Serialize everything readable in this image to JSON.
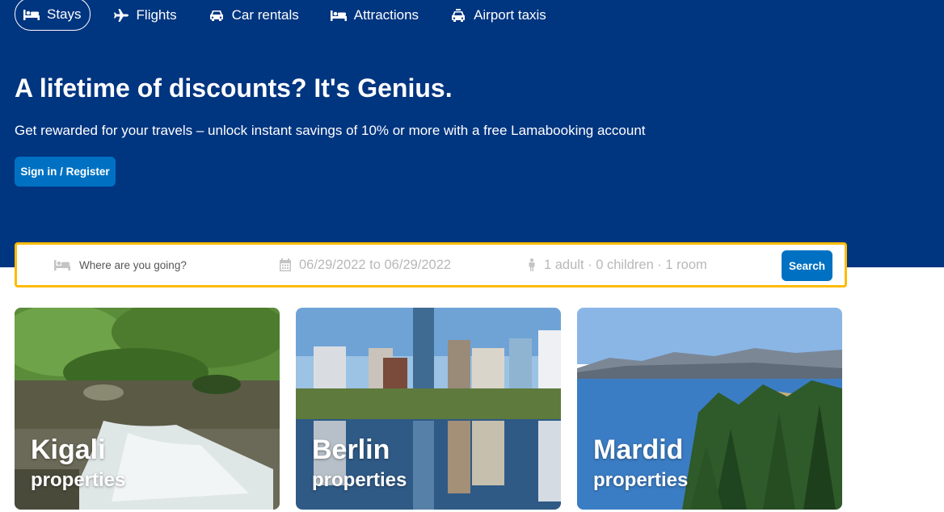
{
  "nav": {
    "items": [
      {
        "label": "Stays",
        "icon": "bed-icon",
        "active": true
      },
      {
        "label": "Flights",
        "icon": "plane-icon",
        "active": false
      },
      {
        "label": "Car rentals",
        "icon": "car-icon",
        "active": false
      },
      {
        "label": "Attractions",
        "icon": "bed-icon",
        "active": false
      },
      {
        "label": "Airport taxis",
        "icon": "taxi-icon",
        "active": false
      }
    ]
  },
  "hero": {
    "headline": "A lifetime of discounts? It's Genius.",
    "subline": "Get rewarded for your travels – unlock instant savings of 10% or more with a free Lamabooking account",
    "signin_label": "Sign in / Register"
  },
  "search": {
    "destination_placeholder": "Where are you going?",
    "dates": "06/29/2022 to 06/29/2022",
    "guests": "1 adult · 0 children · 1 room",
    "button_label": "Search"
  },
  "featured": [
    {
      "city": "Kigali",
      "label": "properties"
    },
    {
      "city": "Berlin",
      "label": "properties"
    },
    {
      "city": "Mardid",
      "label": "properties"
    }
  ],
  "colors": {
    "brand": "#003580",
    "accent": "#0071c2",
    "search_border": "#febb02"
  }
}
